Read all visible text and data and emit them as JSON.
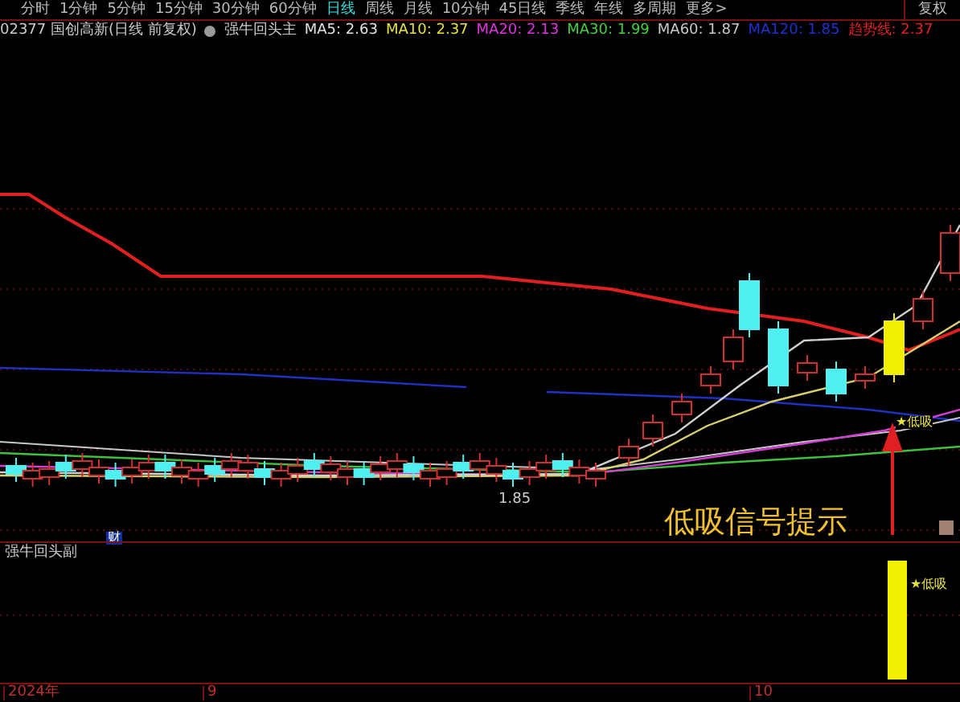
{
  "toolbar": {
    "tabs": [
      {
        "label": "分时",
        "selected": false
      },
      {
        "label": "1分钟",
        "selected": false
      },
      {
        "label": "5分钟",
        "selected": false
      },
      {
        "label": "15分钟",
        "selected": false
      },
      {
        "label": "30分钟",
        "selected": false
      },
      {
        "label": "60分钟",
        "selected": false
      },
      {
        "label": "日线",
        "selected": true
      },
      {
        "label": "周线",
        "selected": false
      },
      {
        "label": "月线",
        "selected": false
      },
      {
        "label": "10分钟",
        "selected": false
      },
      {
        "label": "45日线",
        "selected": false
      },
      {
        "label": "季线",
        "selected": false
      },
      {
        "label": "年线",
        "selected": false
      },
      {
        "label": "多周期",
        "selected": false
      },
      {
        "label": "更多>",
        "selected": false
      }
    ],
    "right_button": "复权"
  },
  "legend": {
    "title": "02377 国创高新(日线 前复权)",
    "indicator": "强牛回头主",
    "lines": [
      {
        "label": "MA5: 2.63",
        "color": "#e0e0e0"
      },
      {
        "label": "MA10: 2.37",
        "color": "#e8e040"
      },
      {
        "label": "MA20: 2.13",
        "color": "#e030e0"
      },
      {
        "label": "MA30: 1.99",
        "color": "#40d040"
      },
      {
        "label": "MA60: 1.87",
        "color": "#c8c8c8"
      },
      {
        "label": "MA120: 1.85",
        "color": "#2030d0"
      },
      {
        "label": "趋势线: 2.37",
        "color": "#e02020"
      }
    ]
  },
  "main_chart": {
    "low_label": "1.85",
    "finance_badge": "财",
    "signal_label": "★低吸",
    "annotation": "低吸信号提示"
  },
  "sub_chart": {
    "title": "强牛回头副",
    "signal_label": "★低吸"
  },
  "time_axis": [
    "2024年",
    "9",
    "10"
  ]
}
